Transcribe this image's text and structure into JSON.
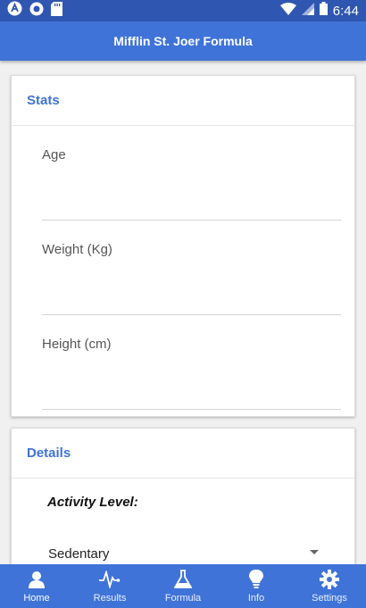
{
  "status_bar": {
    "time": "6:44",
    "icons": [
      "a-icon",
      "circle-icon",
      "sd-card-icon",
      "wifi-icon",
      "signal-icon",
      "battery-icon"
    ]
  },
  "app_bar": {
    "title": "Mifflin St. Joer Formula"
  },
  "stats_card": {
    "title": "Stats",
    "fields": [
      {
        "label": "Age",
        "value": ""
      },
      {
        "label": "Weight (Kg)",
        "value": ""
      },
      {
        "label": "Height (cm)",
        "value": ""
      }
    ]
  },
  "details_card": {
    "title": "Details",
    "activity_label": "Activity Level:",
    "activity_value": "Sedentary"
  },
  "tabs": [
    {
      "label": "Home",
      "icon": "person-icon",
      "active": true
    },
    {
      "label": "Results",
      "icon": "pulse-icon",
      "active": false
    },
    {
      "label": "Formula",
      "icon": "flask-icon",
      "active": false
    },
    {
      "label": "Info",
      "icon": "lightbulb-icon",
      "active": false
    },
    {
      "label": "Settings",
      "icon": "gear-icon",
      "active": false
    }
  ],
  "colors": {
    "primary": "#3f73d8",
    "status_bar": "#2f56b0",
    "accent_text": "#3f73d8"
  }
}
